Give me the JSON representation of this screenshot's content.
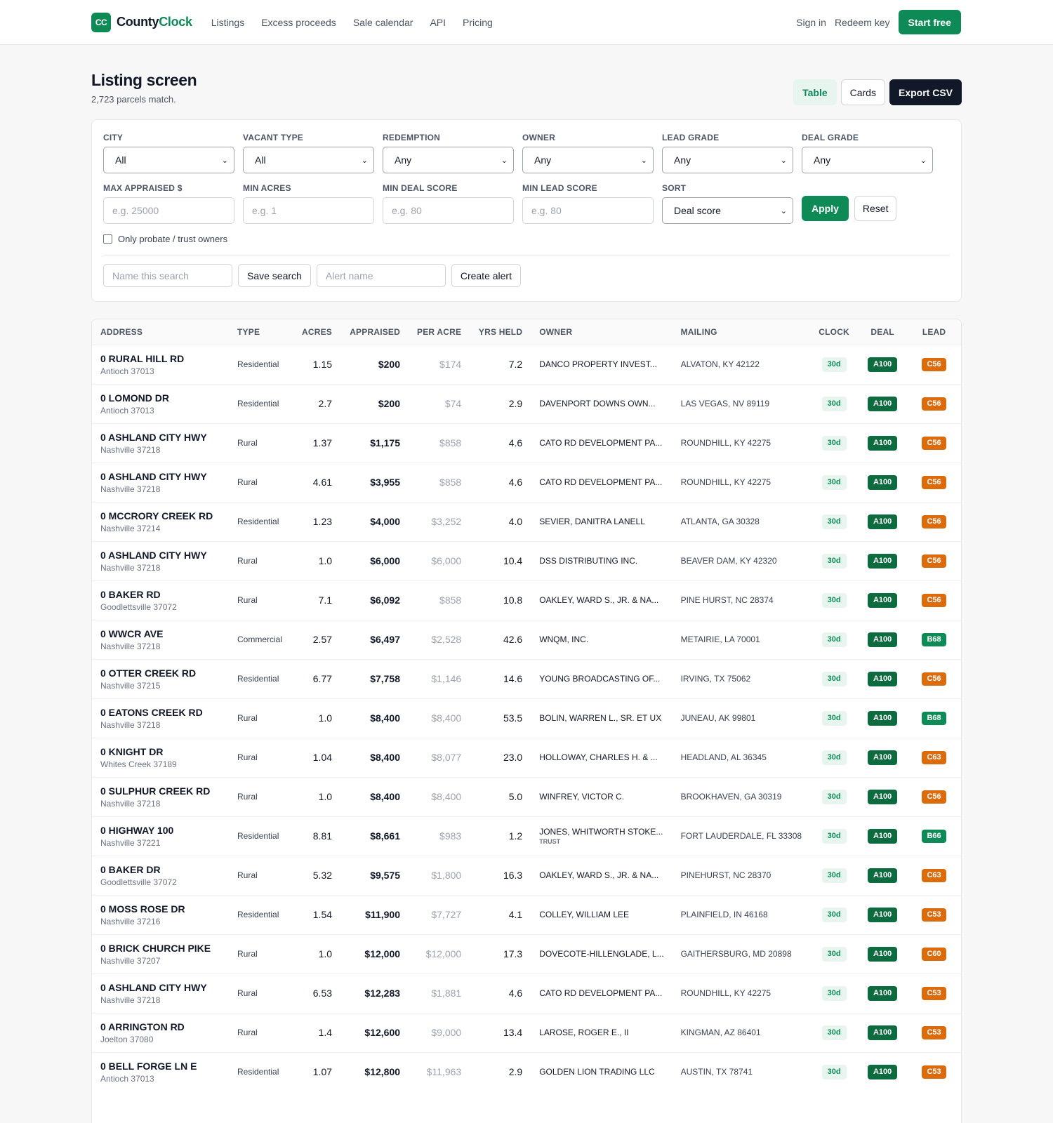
{
  "nav": {
    "logo": "CC",
    "brand_a": "County",
    "brand_b": "Clock",
    "links": [
      "Listings",
      "Excess proceeds",
      "Sale calendar",
      "API",
      "Pricing"
    ],
    "sign_in": "Sign in",
    "redeem": "Redeem key",
    "start": "Start free"
  },
  "header": {
    "title": "Listing screen",
    "subtitle": "2,723 parcels match.",
    "view_table": "Table",
    "view_cards": "Cards",
    "export": "Export CSV"
  },
  "filters": {
    "city": {
      "label": "City",
      "value": "All"
    },
    "vacant_type": {
      "label": "Vacant type",
      "value": "All"
    },
    "redemption": {
      "label": "Redemption",
      "value": "Any"
    },
    "owner": {
      "label": "Owner",
      "value": "Any"
    },
    "lead_grade": {
      "label": "Lead grade",
      "value": "Any"
    },
    "deal_grade": {
      "label": "Deal grade",
      "value": "Any"
    },
    "max_appraised": {
      "label": "Max appraised $",
      "placeholder": "e.g. 25000"
    },
    "min_acres": {
      "label": "Min acres",
      "placeholder": "e.g. 1"
    },
    "min_deal": {
      "label": "Min deal score",
      "placeholder": "e.g. 80"
    },
    "min_lead": {
      "label": "Min lead score",
      "placeholder": "e.g. 80"
    },
    "sort": {
      "label": "Sort",
      "value": "Deal score"
    },
    "apply": "Apply",
    "reset": "Reset",
    "probate": "Only probate / trust owners",
    "search_name_placeholder": "Name this search",
    "save_search": "Save search",
    "alert_name_placeholder": "Alert name",
    "create_alert": "Create alert"
  },
  "table": {
    "columns": [
      "Address",
      "Type",
      "Acres",
      "Appraised",
      "Per acre",
      "Yrs held",
      "Owner",
      "Mailing",
      "Clock",
      "Deal",
      "Lead"
    ],
    "rows": [
      {
        "address": "0 RURAL HILL RD",
        "city": "Antioch 37013",
        "type": "Residential",
        "acres": "1.15",
        "appraised": "$200",
        "per_acre": "$174",
        "yrs": "7.2",
        "owner": "DANCO PROPERTY INVEST...",
        "owner_tag": "",
        "mailing": "ALVATON, KY 42122",
        "clock": "30d",
        "deal": "A100",
        "lead": "C56"
      },
      {
        "address": "0 LOMOND DR",
        "city": "Antioch 37013",
        "type": "Residential",
        "acres": "2.7",
        "appraised": "$200",
        "per_acre": "$74",
        "yrs": "2.9",
        "owner": "DAVENPORT DOWNS OWN...",
        "owner_tag": "",
        "mailing": "LAS VEGAS, NV 89119",
        "clock": "30d",
        "deal": "A100",
        "lead": "C56"
      },
      {
        "address": "0 ASHLAND CITY HWY",
        "city": "Nashville 37218",
        "type": "Rural",
        "acres": "1.37",
        "appraised": "$1,175",
        "per_acre": "$858",
        "yrs": "4.6",
        "owner": "CATO RD DEVELOPMENT PA...",
        "owner_tag": "",
        "mailing": "ROUNDHILL, KY 42275",
        "clock": "30d",
        "deal": "A100",
        "lead": "C56"
      },
      {
        "address": "0 ASHLAND CITY HWY",
        "city": "Nashville 37218",
        "type": "Rural",
        "acres": "4.61",
        "appraised": "$3,955",
        "per_acre": "$858",
        "yrs": "4.6",
        "owner": "CATO RD DEVELOPMENT PA...",
        "owner_tag": "",
        "mailing": "ROUNDHILL, KY 42275",
        "clock": "30d",
        "deal": "A100",
        "lead": "C56"
      },
      {
        "address": "0 MCCRORY CREEK RD",
        "city": "Nashville 37214",
        "type": "Residential",
        "acres": "1.23",
        "appraised": "$4,000",
        "per_acre": "$3,252",
        "yrs": "4.0",
        "owner": "SEVIER, DANITRA LANELL",
        "owner_tag": "",
        "mailing": "ATLANTA, GA 30328",
        "clock": "30d",
        "deal": "A100",
        "lead": "C56"
      },
      {
        "address": "0 ASHLAND CITY HWY",
        "city": "Nashville 37218",
        "type": "Rural",
        "acres": "1.0",
        "appraised": "$6,000",
        "per_acre": "$6,000",
        "yrs": "10.4",
        "owner": "DSS DISTRIBUTING INC.",
        "owner_tag": "",
        "mailing": "BEAVER DAM, KY 42320",
        "clock": "30d",
        "deal": "A100",
        "lead": "C56"
      },
      {
        "address": "0 BAKER RD",
        "city": "Goodlettsville 37072",
        "type": "Rural",
        "acres": "7.1",
        "appraised": "$6,092",
        "per_acre": "$858",
        "yrs": "10.8",
        "owner": "OAKLEY, WARD S., JR. & NA...",
        "owner_tag": "",
        "mailing": "PINE HURST, NC 28374",
        "clock": "30d",
        "deal": "A100",
        "lead": "C56"
      },
      {
        "address": "0 WWCR AVE",
        "city": "Nashville 37218",
        "type": "Commercial",
        "acres": "2.57",
        "appraised": "$6,497",
        "per_acre": "$2,528",
        "yrs": "42.6",
        "owner": "WNQM, INC.",
        "owner_tag": "",
        "mailing": "METAIRIE, LA 70001",
        "clock": "30d",
        "deal": "A100",
        "lead": "B68"
      },
      {
        "address": "0 OTTER CREEK RD",
        "city": "Nashville 37215",
        "type": "Residential",
        "acres": "6.77",
        "appraised": "$7,758",
        "per_acre": "$1,146",
        "yrs": "14.6",
        "owner": "YOUNG BROADCASTING OF...",
        "owner_tag": "",
        "mailing": "IRVING, TX 75062",
        "clock": "30d",
        "deal": "A100",
        "lead": "C56"
      },
      {
        "address": "0 EATONS CREEK RD",
        "city": "Nashville 37218",
        "type": "Rural",
        "acres": "1.0",
        "appraised": "$8,400",
        "per_acre": "$8,400",
        "yrs": "53.5",
        "owner": "BOLIN, WARREN L., SR. ET UX",
        "owner_tag": "",
        "mailing": "JUNEAU, AK 99801",
        "clock": "30d",
        "deal": "A100",
        "lead": "B68"
      },
      {
        "address": "0 KNIGHT DR",
        "city": "Whites Creek 37189",
        "type": "Rural",
        "acres": "1.04",
        "appraised": "$8,400",
        "per_acre": "$8,077",
        "yrs": "23.0",
        "owner": "HOLLOWAY, CHARLES H. & ...",
        "owner_tag": "",
        "mailing": "HEADLAND, AL 36345",
        "clock": "30d",
        "deal": "A100",
        "lead": "C63"
      },
      {
        "address": "0 SULPHUR CREEK RD",
        "city": "Nashville 37218",
        "type": "Rural",
        "acres": "1.0",
        "appraised": "$8,400",
        "per_acre": "$8,400",
        "yrs": "5.0",
        "owner": "WINFREY, VICTOR C.",
        "owner_tag": "",
        "mailing": "BROOKHAVEN, GA 30319",
        "clock": "30d",
        "deal": "A100",
        "lead": "C56"
      },
      {
        "address": "0 HIGHWAY 100",
        "city": "Nashville 37221",
        "type": "Residential",
        "acres": "8.81",
        "appraised": "$8,661",
        "per_acre": "$983",
        "yrs": "1.2",
        "owner": "JONES, WHITWORTH STOKE...",
        "owner_tag": "TRUST",
        "mailing": "FORT LAUDERDALE, FL 33308",
        "clock": "30d",
        "deal": "A100",
        "lead": "B66"
      },
      {
        "address": "0 BAKER DR",
        "city": "Goodlettsville 37072",
        "type": "Rural",
        "acres": "5.32",
        "appraised": "$9,575",
        "per_acre": "$1,800",
        "yrs": "16.3",
        "owner": "OAKLEY, WARD S., JR. & NA...",
        "owner_tag": "",
        "mailing": "PINEHURST, NC 28370",
        "clock": "30d",
        "deal": "A100",
        "lead": "C63"
      },
      {
        "address": "0 MOSS ROSE DR",
        "city": "Nashville 37216",
        "type": "Residential",
        "acres": "1.54",
        "appraised": "$11,900",
        "per_acre": "$7,727",
        "yrs": "4.1",
        "owner": "COLLEY, WILLIAM LEE",
        "owner_tag": "",
        "mailing": "PLAINFIELD, IN 46168",
        "clock": "30d",
        "deal": "A100",
        "lead": "C53"
      },
      {
        "address": "0 BRICK CHURCH PIKE",
        "city": "Nashville 37207",
        "type": "Rural",
        "acres": "1.0",
        "appraised": "$12,000",
        "per_acre": "$12,000",
        "yrs": "17.3",
        "owner": "DOVECOTE-HILLENGLADE, L...",
        "owner_tag": "",
        "mailing": "GAITHERSBURG, MD 20898",
        "clock": "30d",
        "deal": "A100",
        "lead": "C60"
      },
      {
        "address": "0 ASHLAND CITY HWY",
        "city": "Nashville 37218",
        "type": "Rural",
        "acres": "6.53",
        "appraised": "$12,283",
        "per_acre": "$1,881",
        "yrs": "4.6",
        "owner": "CATO RD DEVELOPMENT PA...",
        "owner_tag": "",
        "mailing": "ROUNDHILL, KY 42275",
        "clock": "30d",
        "deal": "A100",
        "lead": "C53"
      },
      {
        "address": "0 ARRINGTON RD",
        "city": "Joelton 37080",
        "type": "Rural",
        "acres": "1.4",
        "appraised": "$12,600",
        "per_acre": "$9,000",
        "yrs": "13.4",
        "owner": "LAROSE, ROGER E., II",
        "owner_tag": "",
        "mailing": "KINGMAN, AZ 86401",
        "clock": "30d",
        "deal": "A100",
        "lead": "C53"
      },
      {
        "address": "0 BELL FORGE LN E",
        "city": "Antioch 37013",
        "type": "Residential",
        "acres": "1.07",
        "appraised": "$12,800",
        "per_acre": "$11,963",
        "yrs": "2.9",
        "owner": "GOLDEN LION TRADING LLC",
        "owner_tag": "",
        "mailing": "AUSTIN, TX 78741",
        "clock": "30d",
        "deal": "A100",
        "lead": "C53"
      }
    ]
  }
}
